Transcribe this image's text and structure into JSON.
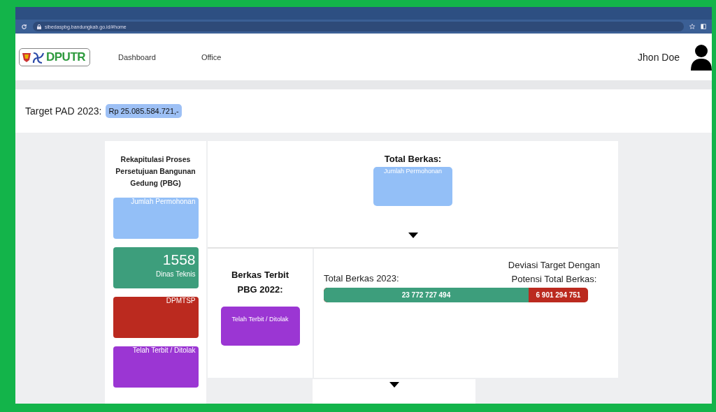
{
  "browser": {
    "url": "sibedaspbg.bandungkab.go.id/#home"
  },
  "header": {
    "logo": "DPUTR",
    "nav": [
      {
        "label": "Dashboard"
      },
      {
        "label": "Office"
      }
    ],
    "user": "Jhon Doe"
  },
  "target": {
    "label": "Target PAD 2023:",
    "value": "Rp 25.085.584.721,-"
  },
  "summary": {
    "title": "Rekapitulasi Proses Persetujuan Bangunan Gedung (PBG)",
    "cards": [
      {
        "label": "Jumlah Permohonan",
        "color": "#93bff7"
      },
      {
        "value": "1558",
        "label": "Dinas Teknis",
        "color": "#3d9e7c"
      },
      {
        "label": "DPMTSP",
        "color": "#bb2a1f"
      },
      {
        "label": "Telah Terbit / Ditolak",
        "color": "#9b36d3"
      }
    ]
  },
  "total": {
    "title": "Total Berkas:",
    "card": {
      "label": "Jumlah Permohonan",
      "color": "#93bff7"
    }
  },
  "issued": {
    "title": "Berkas Terbit PBG 2022:",
    "card": {
      "label": "Telah Terbit / Ditolak",
      "color": "#9b36d3"
    }
  },
  "progress": {
    "label": "Total Berkas 2023:",
    "deviation_label": "Deviasi Target Dengan Potensi Total Berkas:",
    "level": 0.775,
    "achieved": "23 772 727 494",
    "remaining": "6 901 294 751"
  }
}
